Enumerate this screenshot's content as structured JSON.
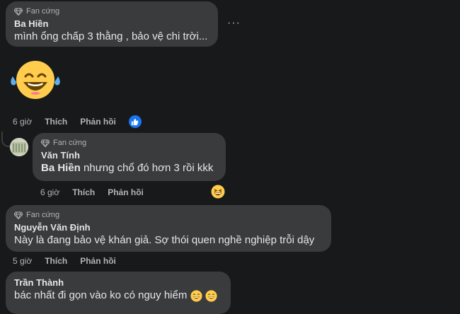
{
  "comments": [
    {
      "badge": "Fan cứng",
      "author": "Ba Hiền",
      "text": "mình ổng chấp 3 thằng , bảo vệ chi trời...",
      "time": "6 giờ",
      "like": "Thích",
      "reply": "Phản hồi",
      "more": "···"
    },
    {
      "badge": "Fan cứng",
      "author": "Văn Tính",
      "mention": "Ba Hiền",
      "text": " nhưng chổ đó hơn 3 rồi kkk",
      "time": "6 giờ",
      "like": "Thích",
      "reply": "Phản hồi"
    },
    {
      "badge": "Fan cứng",
      "author": "Nguyễn Văn Định",
      "text": "Này là đang bảo vệ khán giả. Sợ thói quen nghề nghiệp trỗi dậy",
      "time": "5 giờ",
      "like": "Thích",
      "reply": "Phản hồi"
    },
    {
      "author": "Trần Thành",
      "text": "bác nhất đi gọn vào ko có nguy hiểm"
    }
  ],
  "colors": {
    "background": "#18191a",
    "bubble": "#3a3b3c",
    "text": "#e4e6eb",
    "muted": "#b0b3b8",
    "like_blue": "#1877f2",
    "emoji_yellow": "#ffcc4d"
  },
  "icons": [
    "diamond-icon",
    "more-options-icon",
    "crying-laughing-emoji",
    "like-reaction-icon",
    "grinning-emoji",
    "laughing-emoji"
  ]
}
